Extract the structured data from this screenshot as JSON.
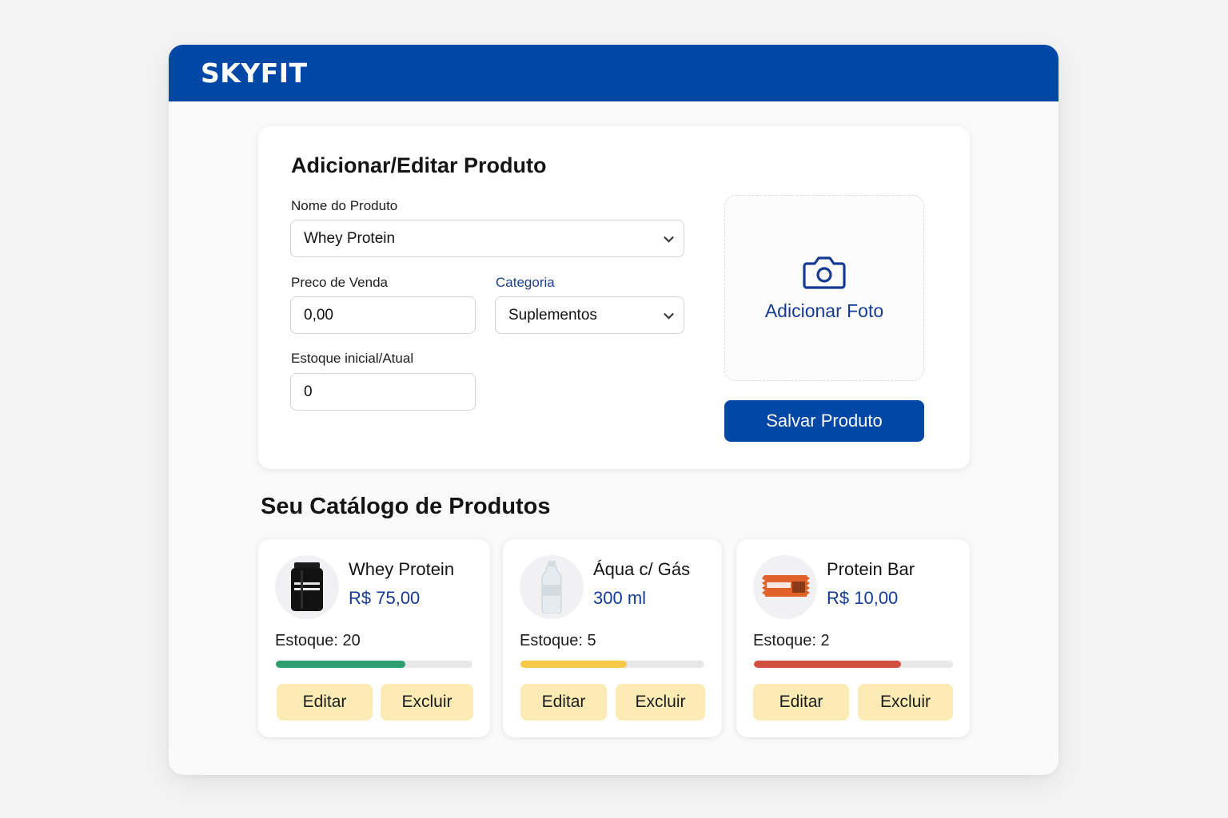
{
  "app": {
    "brand": "SKYFIT",
    "brand_color": "#0047a6"
  },
  "form": {
    "title": "Adicionar/Editar Produto",
    "name_label": "Nome do Produto",
    "name_value": "Whey Protein",
    "price_label": "Preco de Venda",
    "price_value": "0,00",
    "category_label": "Categoria",
    "category_value": "Suplementos",
    "stock_label": "Estoque inicial/Atual",
    "stock_value": "0",
    "photo_label": "Adicionar Foto",
    "photo_icon": "camera-icon",
    "save_label": "Salvar Produto"
  },
  "catalog": {
    "title": "Seu Catálogo de Produtos",
    "items": [
      {
        "name": "Whey Protein",
        "subtitle": "R$ 75,00",
        "stock_text": "Estoque: 20",
        "stock_level": 0.66,
        "bar_color": "#2e9e6e",
        "image": "protein-tub-icon",
        "edit_label": "Editar",
        "delete_label": "Excluir"
      },
      {
        "name": "Áqua c/ Gás",
        "subtitle": "300 ml",
        "stock_text": "Estoque: 5",
        "stock_level": 0.58,
        "bar_color": "#f7c948",
        "image": "water-bottle-icon",
        "edit_label": "Editar",
        "delete_label": "Excluir"
      },
      {
        "name": "Protein Bar",
        "subtitle": "R$ 10,00",
        "stock_text": "Estoque: 2",
        "stock_level": 0.74,
        "bar_color": "#d2503f",
        "image": "protein-bar-icon",
        "edit_label": "Editar",
        "delete_label": "Excluir"
      }
    ]
  }
}
